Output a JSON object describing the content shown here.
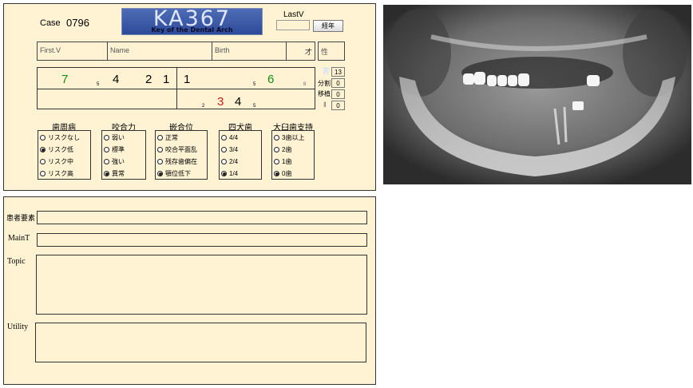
{
  "header": {
    "case_label": "Case",
    "case_number": "0796",
    "logo_main": "KA367",
    "logo_sub": "Key of the Dental Arch",
    "lastv_label": "LastV",
    "lastv_value": "",
    "keinen_button": "経年"
  },
  "fields": {
    "first_visit": "First.V",
    "name": "Name",
    "birth": "Birth",
    "age": "才",
    "sex": "性"
  },
  "dental_chart": {
    "upper_right": [
      {
        "text": "7",
        "color": "green"
      },
      {
        "text": "5",
        "small": true
      },
      {
        "text": "4"
      },
      {
        "text": "2"
      },
      {
        "text": "1"
      }
    ],
    "upper_left": [
      {
        "text": "1"
      },
      {
        "text": "5",
        "small": true
      },
      {
        "text": "6",
        "color": "green"
      },
      {
        "text": "8",
        "small": true
      }
    ],
    "lower_left": [
      {
        "text": "2",
        "small": true
      },
      {
        "text": "3",
        "color": "red"
      },
      {
        "text": "4"
      },
      {
        "text": "5",
        "small": true
      }
    ]
  },
  "stats": {
    "tooth_count": "13",
    "bunkatsu_label": "分割",
    "bunkatsu_value": "0",
    "ishoku_label": "移植",
    "ishoku_value": "0",
    "implant_value": "0"
  },
  "groups": [
    {
      "title": "歯周病",
      "options": [
        {
          "label": "リスクなし",
          "selected": false
        },
        {
          "label": "リスク低",
          "selected": true
        },
        {
          "label": "リスク中",
          "selected": false
        },
        {
          "label": "リスク高",
          "selected": false
        }
      ]
    },
    {
      "title": "咬合力",
      "options": [
        {
          "label": "弱い",
          "selected": false
        },
        {
          "label": "標準",
          "selected": false
        },
        {
          "label": "強い",
          "selected": false
        },
        {
          "label": "異常",
          "selected": true
        }
      ]
    },
    {
      "title": "嵌合位",
      "options": [
        {
          "label": "正常",
          "selected": false
        },
        {
          "label": "咬合平面乱",
          "selected": false
        },
        {
          "label": "残存歯偏在",
          "selected": false
        },
        {
          "label": "顎位低下",
          "selected": true
        }
      ]
    },
    {
      "title": "四犬歯",
      "options": [
        {
          "label": "4/4",
          "selected": false
        },
        {
          "label": "3/4",
          "selected": false
        },
        {
          "label": "2/4",
          "selected": false
        },
        {
          "label": "1/4",
          "selected": true
        }
      ]
    },
    {
      "title": "大臼歯支持",
      "options": [
        {
          "label": "3歯以上",
          "selected": false
        },
        {
          "label": "2歯",
          "selected": false
        },
        {
          "label": "1歯",
          "selected": false
        },
        {
          "label": "0歯",
          "selected": true
        }
      ]
    }
  ],
  "bottom": {
    "patient_factors_label": "患者要素",
    "maint_label": "MainT",
    "topic_label": "Topic",
    "utility_label": "Utility"
  },
  "colors": {
    "panel_bg": "#fff3d4",
    "logo_blue": "#3a58a8",
    "tooth_green": "#138a13",
    "tooth_red": "#d01b1b"
  }
}
